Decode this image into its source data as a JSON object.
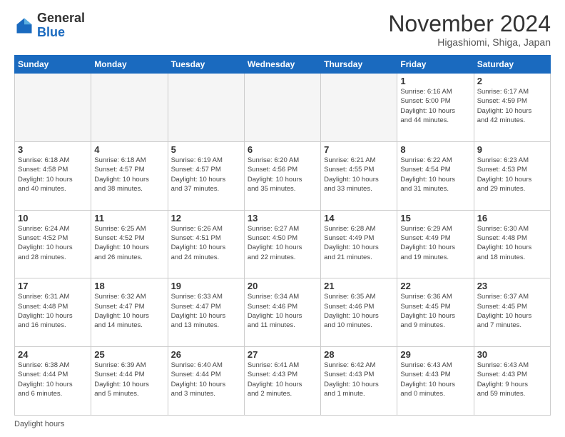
{
  "logo": {
    "general": "General",
    "blue": "Blue"
  },
  "title": {
    "main": "November 2024",
    "sub": "Higashiomi, Shiga, Japan"
  },
  "weekdays": [
    "Sunday",
    "Monday",
    "Tuesday",
    "Wednesday",
    "Thursday",
    "Friday",
    "Saturday"
  ],
  "footer": {
    "daylight_label": "Daylight hours"
  },
  "weeks": [
    [
      {
        "day": "",
        "info": ""
      },
      {
        "day": "",
        "info": ""
      },
      {
        "day": "",
        "info": ""
      },
      {
        "day": "",
        "info": ""
      },
      {
        "day": "",
        "info": ""
      },
      {
        "day": "1",
        "info": "Sunrise: 6:16 AM\nSunset: 5:00 PM\nDaylight: 10 hours\nand 44 minutes."
      },
      {
        "day": "2",
        "info": "Sunrise: 6:17 AM\nSunset: 4:59 PM\nDaylight: 10 hours\nand 42 minutes."
      }
    ],
    [
      {
        "day": "3",
        "info": "Sunrise: 6:18 AM\nSunset: 4:58 PM\nDaylight: 10 hours\nand 40 minutes."
      },
      {
        "day": "4",
        "info": "Sunrise: 6:18 AM\nSunset: 4:57 PM\nDaylight: 10 hours\nand 38 minutes."
      },
      {
        "day": "5",
        "info": "Sunrise: 6:19 AM\nSunset: 4:57 PM\nDaylight: 10 hours\nand 37 minutes."
      },
      {
        "day": "6",
        "info": "Sunrise: 6:20 AM\nSunset: 4:56 PM\nDaylight: 10 hours\nand 35 minutes."
      },
      {
        "day": "7",
        "info": "Sunrise: 6:21 AM\nSunset: 4:55 PM\nDaylight: 10 hours\nand 33 minutes."
      },
      {
        "day": "8",
        "info": "Sunrise: 6:22 AM\nSunset: 4:54 PM\nDaylight: 10 hours\nand 31 minutes."
      },
      {
        "day": "9",
        "info": "Sunrise: 6:23 AM\nSunset: 4:53 PM\nDaylight: 10 hours\nand 29 minutes."
      }
    ],
    [
      {
        "day": "10",
        "info": "Sunrise: 6:24 AM\nSunset: 4:52 PM\nDaylight: 10 hours\nand 28 minutes."
      },
      {
        "day": "11",
        "info": "Sunrise: 6:25 AM\nSunset: 4:52 PM\nDaylight: 10 hours\nand 26 minutes."
      },
      {
        "day": "12",
        "info": "Sunrise: 6:26 AM\nSunset: 4:51 PM\nDaylight: 10 hours\nand 24 minutes."
      },
      {
        "day": "13",
        "info": "Sunrise: 6:27 AM\nSunset: 4:50 PM\nDaylight: 10 hours\nand 22 minutes."
      },
      {
        "day": "14",
        "info": "Sunrise: 6:28 AM\nSunset: 4:49 PM\nDaylight: 10 hours\nand 21 minutes."
      },
      {
        "day": "15",
        "info": "Sunrise: 6:29 AM\nSunset: 4:49 PM\nDaylight: 10 hours\nand 19 minutes."
      },
      {
        "day": "16",
        "info": "Sunrise: 6:30 AM\nSunset: 4:48 PM\nDaylight: 10 hours\nand 18 minutes."
      }
    ],
    [
      {
        "day": "17",
        "info": "Sunrise: 6:31 AM\nSunset: 4:48 PM\nDaylight: 10 hours\nand 16 minutes."
      },
      {
        "day": "18",
        "info": "Sunrise: 6:32 AM\nSunset: 4:47 PM\nDaylight: 10 hours\nand 14 minutes."
      },
      {
        "day": "19",
        "info": "Sunrise: 6:33 AM\nSunset: 4:47 PM\nDaylight: 10 hours\nand 13 minutes."
      },
      {
        "day": "20",
        "info": "Sunrise: 6:34 AM\nSunset: 4:46 PM\nDaylight: 10 hours\nand 11 minutes."
      },
      {
        "day": "21",
        "info": "Sunrise: 6:35 AM\nSunset: 4:46 PM\nDaylight: 10 hours\nand 10 minutes."
      },
      {
        "day": "22",
        "info": "Sunrise: 6:36 AM\nSunset: 4:45 PM\nDaylight: 10 hours\nand 9 minutes."
      },
      {
        "day": "23",
        "info": "Sunrise: 6:37 AM\nSunset: 4:45 PM\nDaylight: 10 hours\nand 7 minutes."
      }
    ],
    [
      {
        "day": "24",
        "info": "Sunrise: 6:38 AM\nSunset: 4:44 PM\nDaylight: 10 hours\nand 6 minutes."
      },
      {
        "day": "25",
        "info": "Sunrise: 6:39 AM\nSunset: 4:44 PM\nDaylight: 10 hours\nand 5 minutes."
      },
      {
        "day": "26",
        "info": "Sunrise: 6:40 AM\nSunset: 4:44 PM\nDaylight: 10 hours\nand 3 minutes."
      },
      {
        "day": "27",
        "info": "Sunrise: 6:41 AM\nSunset: 4:43 PM\nDaylight: 10 hours\nand 2 minutes."
      },
      {
        "day": "28",
        "info": "Sunrise: 6:42 AM\nSunset: 4:43 PM\nDaylight: 10 hours\nand 1 minute."
      },
      {
        "day": "29",
        "info": "Sunrise: 6:43 AM\nSunset: 4:43 PM\nDaylight: 10 hours\nand 0 minutes."
      },
      {
        "day": "30",
        "info": "Sunrise: 6:43 AM\nSunset: 4:43 PM\nDaylight: 9 hours\nand 59 minutes."
      }
    ]
  ]
}
